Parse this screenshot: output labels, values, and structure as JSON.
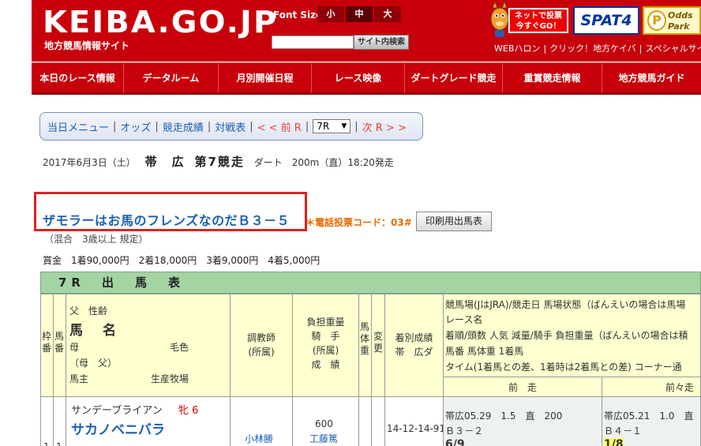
{
  "header": {
    "logo": "KEIBA.GO.JP",
    "subtitle": "地方競馬情報サイト",
    "font_size_label": "Font Size",
    "font_sizes": [
      "小",
      "中",
      "大"
    ],
    "search_button": "サイト内検索",
    "vote_banner_line1": "ネットで投票",
    "vote_banner_line2": "今すぐGO！",
    "spat4": "SPAT4",
    "oddspark_line1": "Odds",
    "oddspark_line2": "Park",
    "links": [
      "WEBハロン",
      "クリック！地方ケイバ",
      "スペシャルサイトIN"
    ]
  },
  "nav": [
    "本日のレース情報",
    "データルーム",
    "月別開催日程",
    "レース映像",
    "ダートグレード競走",
    "重賞競走情報",
    "地方競馬ガイド"
  ],
  "submenu": {
    "items": [
      "当日メニュー",
      "オッズ",
      "競走成績",
      "対戦表"
    ],
    "prev": "< < 前 R",
    "race_select": "7R",
    "next": "次 R > >"
  },
  "race": {
    "date": "2017年6月3日（土）",
    "venue": "帯　広",
    "race_no": "第7競走",
    "track": "ダート　200m（直）18:20発走",
    "title": "ザモラーはお馬のフレンズなのだＢ３－５",
    "vote_code": "＊電話投票コード：03#",
    "print_button": "印刷用出馬表",
    "condition": "（混合　3歳以上 規定）",
    "prize": "賞金　1着90,000円　2着18,000円　3着9,000円　4着5,000円"
  },
  "table": {
    "title": "7R　出　馬　表",
    "col_waku": "枠番",
    "col_uma": "馬番",
    "col_horse": {
      "sire": "父　性齢",
      "name": "馬　名",
      "dam": "母",
      "color": "毛色",
      "damsire": "（母　父）",
      "owner": "馬主",
      "breeder": "生産牧場"
    },
    "col_trainer": "調教師\n(所属)",
    "col_weight": "負担重量\n騎　手\n(所属)\n成　績",
    "col_body": "馬体重",
    "col_change": "変更",
    "col_record": "着別成績\n帯　広ダ",
    "col_past_desc": [
      "競馬場(JはJRA)/競走日 馬場状態（ばんえいの場合は馬場",
      "レース名",
      "着順/頭数 人気 減量/騎手 負担重量（ばんえいの場合は積",
      "馬番 馬体重 1着馬",
      "タイム(1着馬との差、1着時は2着馬との差) コーナー通"
    ],
    "prev1": "前　走",
    "prev2": "前々走",
    "row1": {
      "sire": "サンデーブライアン",
      "sex_age": "牝 6",
      "name": "サカノベニバラ",
      "trainer": "小林勝",
      "weight": "600",
      "jockey": "工藤篤",
      "record": "14-12-14-91",
      "prev1_line1": "帯広05.29　1.5　直　200",
      "prev1_line2": "Ｂ３－２",
      "prev1_line3": "6/9",
      "prev2_line1": "帯広05.21　1.0　直",
      "prev2_line2": "Ｂ４－１",
      "prev2_line3": "1/8"
    }
  }
}
